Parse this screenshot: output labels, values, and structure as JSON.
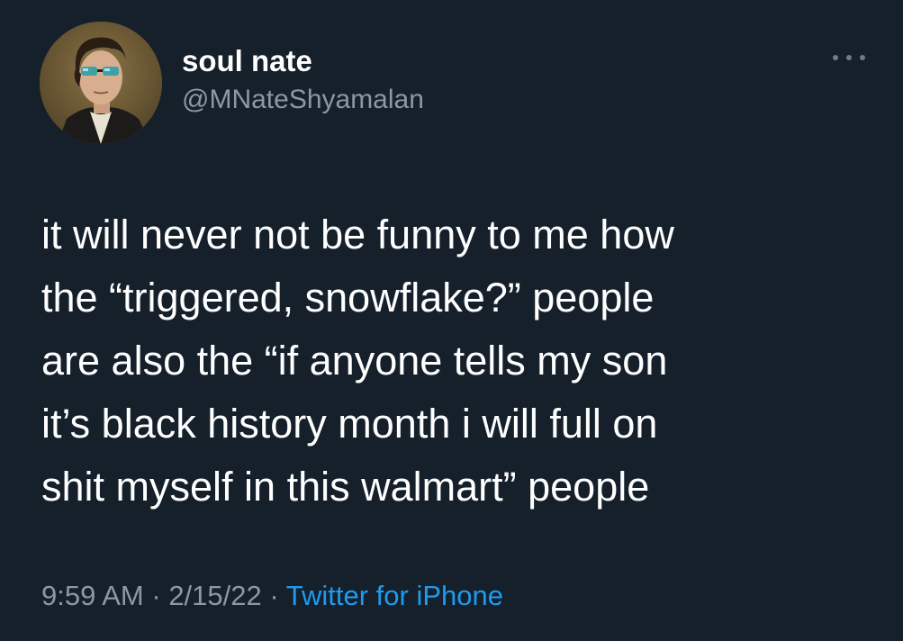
{
  "author": {
    "display_name": "soul nate",
    "handle": "@MNateShyamalan",
    "avatar_icon": "portrait-avatar-with-sunglasses"
  },
  "more_menu": {
    "icon": "more-options-icon"
  },
  "tweet": {
    "lines": [
      "it will never not be funny to me how",
      "the “triggered, snowflake?” people",
      "are also the “if anyone tells my son",
      "it’s black history month i will full on",
      "shit myself in this walmart” people"
    ]
  },
  "meta": {
    "time": "9:59 AM",
    "separator": " · ",
    "date": "2/15/22",
    "source": "Twitter for iPhone"
  },
  "colors": {
    "background": "#15202b",
    "primary_text": "#ffffff",
    "secondary_text": "#8b98a5",
    "link": "#1d9bf0"
  }
}
